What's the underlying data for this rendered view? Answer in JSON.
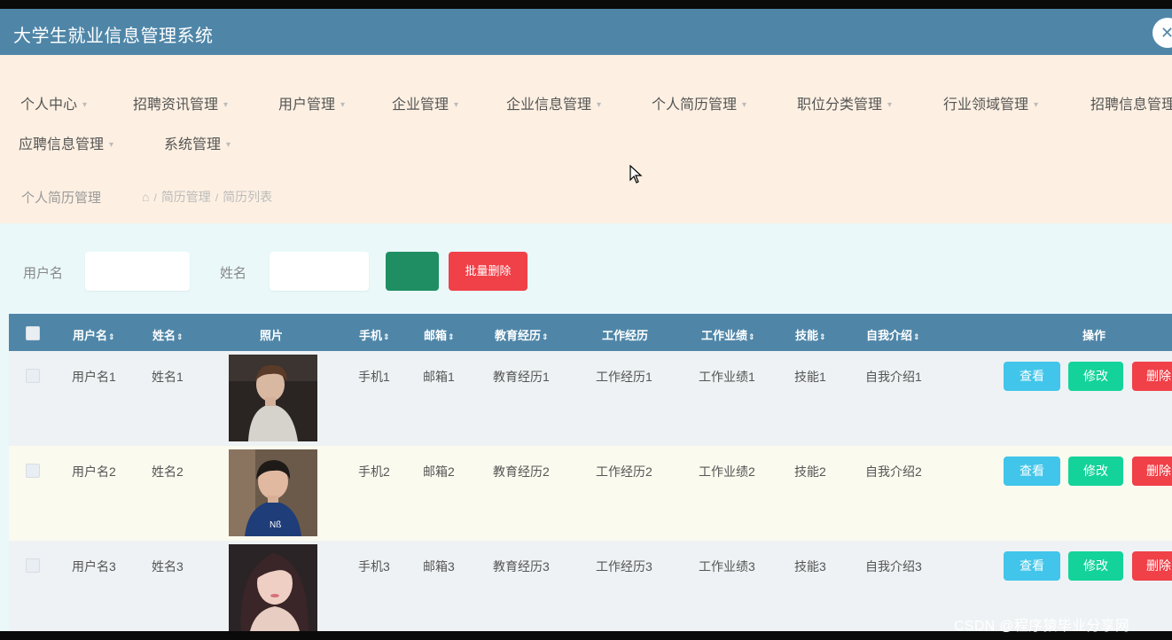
{
  "app": {
    "title": "大学生就业信息管理系统",
    "close_glyph": "✕"
  },
  "nav": [
    {
      "label": "个人中心"
    },
    {
      "label": "招聘资讯管理"
    },
    {
      "label": "用户管理"
    },
    {
      "label": "企业管理"
    },
    {
      "label": "企业信息管理"
    },
    {
      "label": "个人简历管理"
    },
    {
      "label": "职位分类管理"
    },
    {
      "label": "行业领域管理"
    },
    {
      "label": "招聘信息管理"
    },
    {
      "label": "应聘信息管理"
    },
    {
      "label": "系统管理"
    }
  ],
  "breadcrumb": {
    "title": "个人简历管理",
    "home_icon": "home-icon",
    "sep": "/",
    "items": [
      "简历管理",
      "简历列表"
    ]
  },
  "search": {
    "username_label": "用户名",
    "username_value": "",
    "name_label": "姓名",
    "name_value": "",
    "search_button": "",
    "batch_delete": "批量删除"
  },
  "table": {
    "columns": [
      "用户名",
      "姓名",
      "照片",
      "手机",
      "邮箱",
      "教育经历",
      "工作经历",
      "工作业绩",
      "技能",
      "自我介绍",
      "操作"
    ],
    "sort_glyph": "⇕",
    "rows": [
      {
        "username": "用户名1",
        "name": "姓名1",
        "phone": "手机1",
        "email": "邮箱1",
        "education": "教育经历1",
        "work": "工作经历1",
        "achievement": "工作业绩1",
        "skill": "技能1",
        "intro": "自我介绍1"
      },
      {
        "username": "用户名2",
        "name": "姓名2",
        "phone": "手机2",
        "email": "邮箱2",
        "education": "教育经历2",
        "work": "工作经历2",
        "achievement": "工作业绩2",
        "skill": "技能2",
        "intro": "自我介绍2"
      },
      {
        "username": "用户名3",
        "name": "姓名3",
        "phone": "手机3",
        "email": "邮箱3",
        "education": "教育经历3",
        "work": "工作经历3",
        "achievement": "工作业绩3",
        "skill": "技能3",
        "intro": "自我介绍3"
      }
    ],
    "actions": {
      "view": "查看",
      "edit": "修改",
      "delete": "删除"
    }
  },
  "watermark": "CSDN @程序猿毕业分享网",
  "colors": {
    "header": "#4f86a8",
    "nav_bg": "#fdf0e2",
    "content_bg": "#eaf8fa",
    "view": "#41c5ea",
    "edit": "#14d39a",
    "delete": "#f04048",
    "search": "#1f8f63"
  }
}
